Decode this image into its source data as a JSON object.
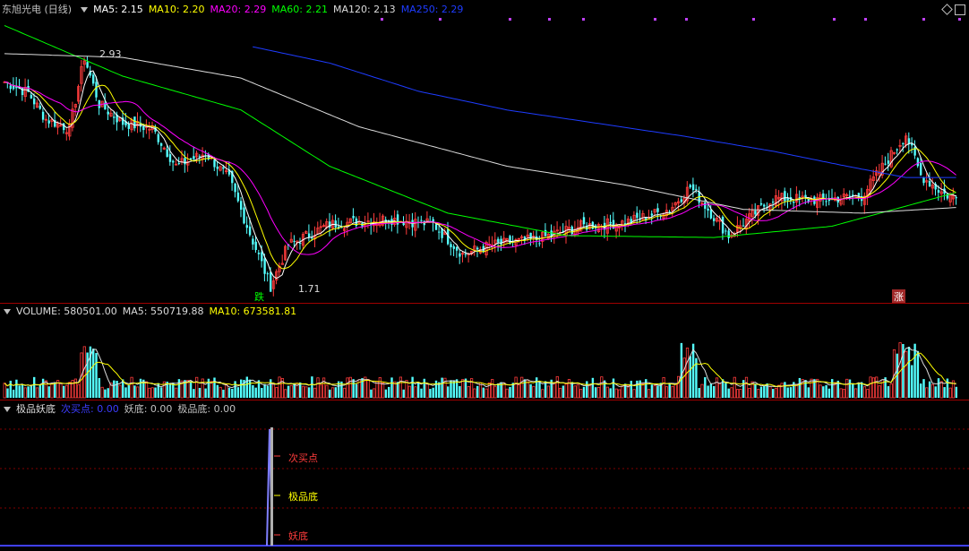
{
  "main": {
    "title": "东旭光电 (日线)",
    "indicators": [
      {
        "text": "MA5: 2.15",
        "color": "#ffffff"
      },
      {
        "text": "MA10: 2.20",
        "color": "#ffff00"
      },
      {
        "text": "MA20: 2.29",
        "color": "#ff00ff"
      },
      {
        "text": "MA60: 2.21",
        "color": "#00ff00"
      },
      {
        "text": "MA120: 2.13",
        "color": "#dcdcdc"
      },
      {
        "text": "MA250: 2.29",
        "color": "#1e3cff"
      }
    ],
    "high_label": "2.93",
    "low_label": "1.71",
    "die_label": "跌",
    "zhang_label": "涨"
  },
  "volume": {
    "indicators": [
      {
        "text": "VOLUME: 580501.00",
        "color": "#dcdcdc"
      },
      {
        "text": "MA5: 550719.88",
        "color": "#dcdcdc"
      },
      {
        "text": "MA10: 673581.81",
        "color": "#ffff00"
      }
    ]
  },
  "sub": {
    "indicators": [
      {
        "text": "极品妖底",
        "color": "#dcdcdc"
      },
      {
        "text": "次买点: 0.00",
        "color": "#3c3cff"
      },
      {
        "text": "妖底: 0.00",
        "color": "#c0c0c0"
      },
      {
        "text": "极品底: 0.00",
        "color": "#c0c0c0"
      }
    ],
    "labels": {
      "buy": "次买点",
      "best": "极品底",
      "yao": "妖底"
    }
  },
  "chart_data": {
    "type": "candlestick",
    "colors": {
      "up": "#ff3c3c",
      "down": "#54ffff",
      "ma5": "#ffffff",
      "ma10": "#ffff00",
      "ma20": "#ff00ff",
      "ma60": "#00ff00",
      "ma120": "#dcdcdc",
      "ma250": "#1e3cff"
    },
    "price_range": [
      1.66,
      3.15
    ],
    "anchor_points": [
      [
        0,
        2.8
      ],
      [
        8,
        2.74
      ],
      [
        14,
        2.6
      ],
      [
        22,
        2.55
      ],
      [
        27,
        2.93
      ],
      [
        32,
        2.68
      ],
      [
        40,
        2.58
      ],
      [
        50,
        2.55
      ],
      [
        58,
        2.35
      ],
      [
        68,
        2.42
      ],
      [
        76,
        2.28
      ],
      [
        84,
        1.95
      ],
      [
        90,
        1.71
      ],
      [
        96,
        1.93
      ],
      [
        110,
        2.04
      ],
      [
        130,
        2.07
      ],
      [
        145,
        2.04
      ],
      [
        155,
        1.88
      ],
      [
        165,
        1.93
      ],
      [
        180,
        1.96
      ],
      [
        195,
        2.03
      ],
      [
        210,
        2.05
      ],
      [
        225,
        2.12
      ],
      [
        232,
        2.24
      ],
      [
        240,
        2.08
      ],
      [
        245,
        1.98
      ],
      [
        260,
        2.18
      ],
      [
        275,
        2.17
      ],
      [
        290,
        2.19
      ],
      [
        300,
        2.41
      ],
      [
        305,
        2.52
      ],
      [
        310,
        2.3
      ],
      [
        318,
        2.2
      ],
      [
        322,
        2.18
      ]
    ],
    "ma250_points": [
      [
        80,
        3.0
      ],
      [
        110,
        2.9
      ],
      [
        140,
        2.75
      ],
      [
        170,
        2.65
      ],
      [
        200,
        2.58
      ],
      [
        230,
        2.51
      ],
      [
        260,
        2.43
      ],
      [
        285,
        2.35
      ],
      [
        305,
        2.29
      ]
    ],
    "volume_peak": 1.0,
    "signal_index": 90
  }
}
